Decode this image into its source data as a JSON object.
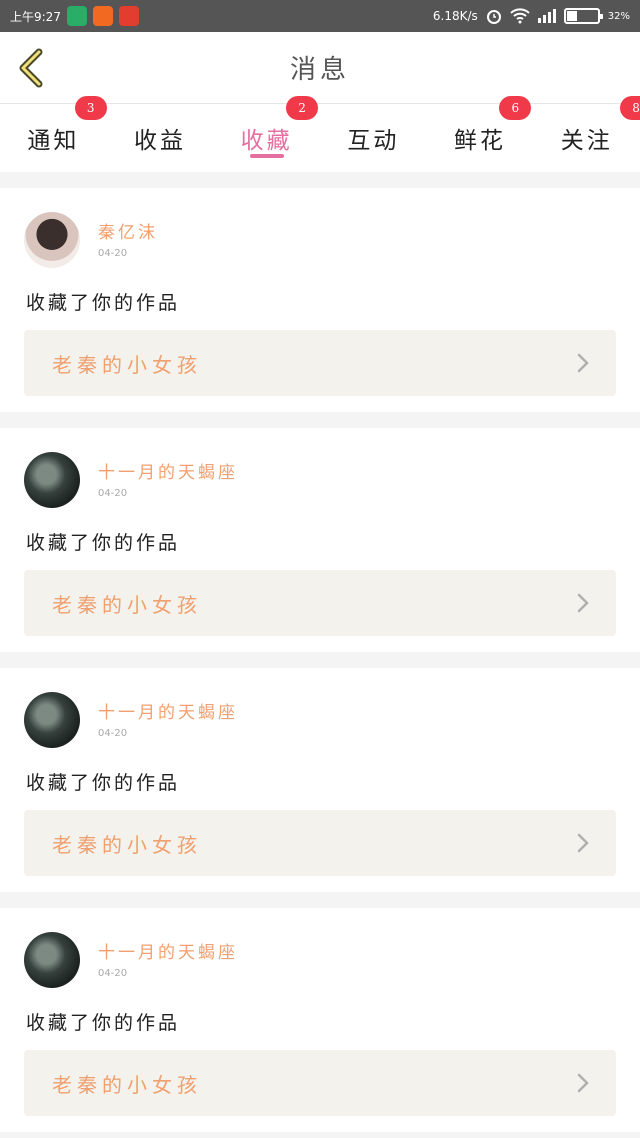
{
  "status_bar": {
    "time": "上午9:27",
    "speed": "6.18K/s",
    "battery": "32%"
  },
  "header": {
    "title": "消息"
  },
  "tabs": [
    {
      "label": "通知",
      "badge": "3",
      "active": false
    },
    {
      "label": "收益",
      "badge": "",
      "active": false
    },
    {
      "label": "收藏",
      "badge": "2",
      "active": true
    },
    {
      "label": "互动",
      "badge": "",
      "active": false
    },
    {
      "label": "鲜花",
      "badge": "6",
      "active": false
    },
    {
      "label": "关注",
      "badge": "8",
      "active": false
    }
  ],
  "cards": [
    {
      "username": "秦亿沫",
      "date": "04-20",
      "action": "收藏了你的作品",
      "work_title": "老秦的小女孩"
    },
    {
      "username": "十一月的天蝎座",
      "date": "04-20",
      "action": "收藏了你的作品",
      "work_title": "老秦的小女孩"
    },
    {
      "username": "十一月的天蝎座",
      "date": "04-20",
      "action": "收藏了你的作品",
      "work_title": "老秦的小女孩"
    },
    {
      "username": "十一月的天蝎座",
      "date": "04-20",
      "action": "收藏了你的作品",
      "work_title": "老秦的小女孩"
    }
  ],
  "colors": {
    "accent_pink": "#e66fa0",
    "badge_red": "#f03a4a",
    "username_orange": "#f0a070"
  }
}
